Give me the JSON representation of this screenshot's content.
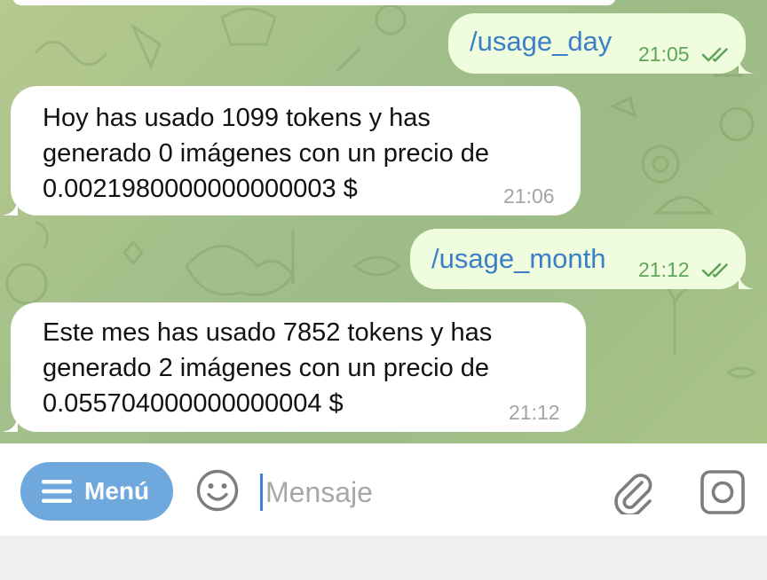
{
  "messages": [
    {
      "direction": "outgoing",
      "text": "/usage_day",
      "time": "21:05",
      "status": "read"
    },
    {
      "direction": "incoming",
      "text": "Hoy has usado 1099 tokens y has\ngenerado 0 imágenes con un precio de\n0.0021980000000000003 $",
      "time": "21:06"
    },
    {
      "direction": "outgoing",
      "text": "/usage_month",
      "time": "21:12",
      "status": "read"
    },
    {
      "direction": "incoming",
      "text": "Este mes has usado 7852 tokens y has\ngenerado 2 imágenes con un precio de\n0.055704000000000004 $",
      "time": "21:12"
    }
  ],
  "composer": {
    "menu_label": "Menú",
    "placeholder": "Mensaje",
    "value": ""
  },
  "icons": {
    "menu": "hamburger-icon",
    "emoji": "smiley-icon",
    "attach": "paperclip-icon",
    "camera": "camera-icon",
    "read_status": "double-check-icon"
  },
  "colors": {
    "outgoing_bubble": "#effdde",
    "incoming_bubble": "#ffffff",
    "command_link": "#3b7fc7",
    "outgoing_time": "#5fa45b",
    "menu_button": "#6fa8dc",
    "chat_background": "#a3c08a"
  }
}
